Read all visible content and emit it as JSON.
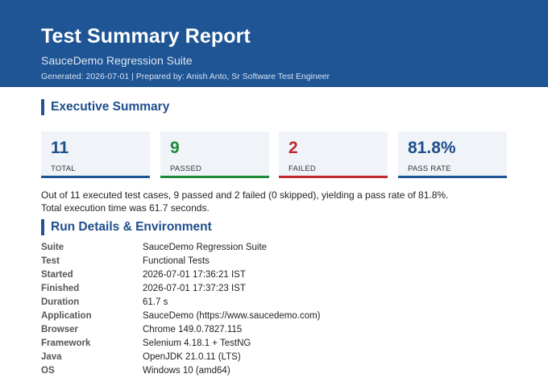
{
  "header": {
    "title": "Test Summary Report",
    "subtitle": "SauceDemo Regression Suite",
    "meta": "Generated: 2026-07-01  |  Prepared by: Anish Anto, Sr Software Test Engineer"
  },
  "executive_summary": {
    "heading": "Executive Summary",
    "cards": [
      {
        "value": "11",
        "label": "TOTAL",
        "value_color": "#1f4e8c",
        "bar_color": "#1f5595"
      },
      {
        "value": "9",
        "label": "PASSED",
        "value_color": "#1e8a3a",
        "bar_color": "#1e8a3a"
      },
      {
        "value": "2",
        "label": "FAILED",
        "value_color": "#c0282d",
        "bar_color": "#c0282d"
      },
      {
        "value": "81.8%",
        "label": "PASS RATE",
        "value_color": "#1f4e8c",
        "bar_color": "#1f5595"
      }
    ],
    "summary_line1": "Out of 11 executed test cases, 9 passed and 2 failed (0 skipped), yielding a pass rate of 81.8%.",
    "summary_line2": "Total execution time was 61.7 seconds."
  },
  "run_details": {
    "heading": "Run Details & Environment",
    "rows": [
      {
        "key": "Suite",
        "value": "SauceDemo Regression Suite"
      },
      {
        "key": "Test",
        "value": "Functional Tests"
      },
      {
        "key": "Started",
        "value": "2026-07-01 17:36:21 IST"
      },
      {
        "key": "Finished",
        "value": "2026-07-01 17:37:23 IST"
      },
      {
        "key": "Duration",
        "value": "61.7 s"
      },
      {
        "key": "Application",
        "value": "SauceDemo (https://www.saucedemo.com)"
      },
      {
        "key": "Browser",
        "value": "Chrome 149.0.7827.115"
      },
      {
        "key": "Framework",
        "value": "Selenium 4.18.1 + TestNG"
      },
      {
        "key": "Java",
        "value": "OpenJDK 21.0.11 (LTS)"
      },
      {
        "key": "OS",
        "value": "Windows 10 (amd64)"
      }
    ]
  }
}
